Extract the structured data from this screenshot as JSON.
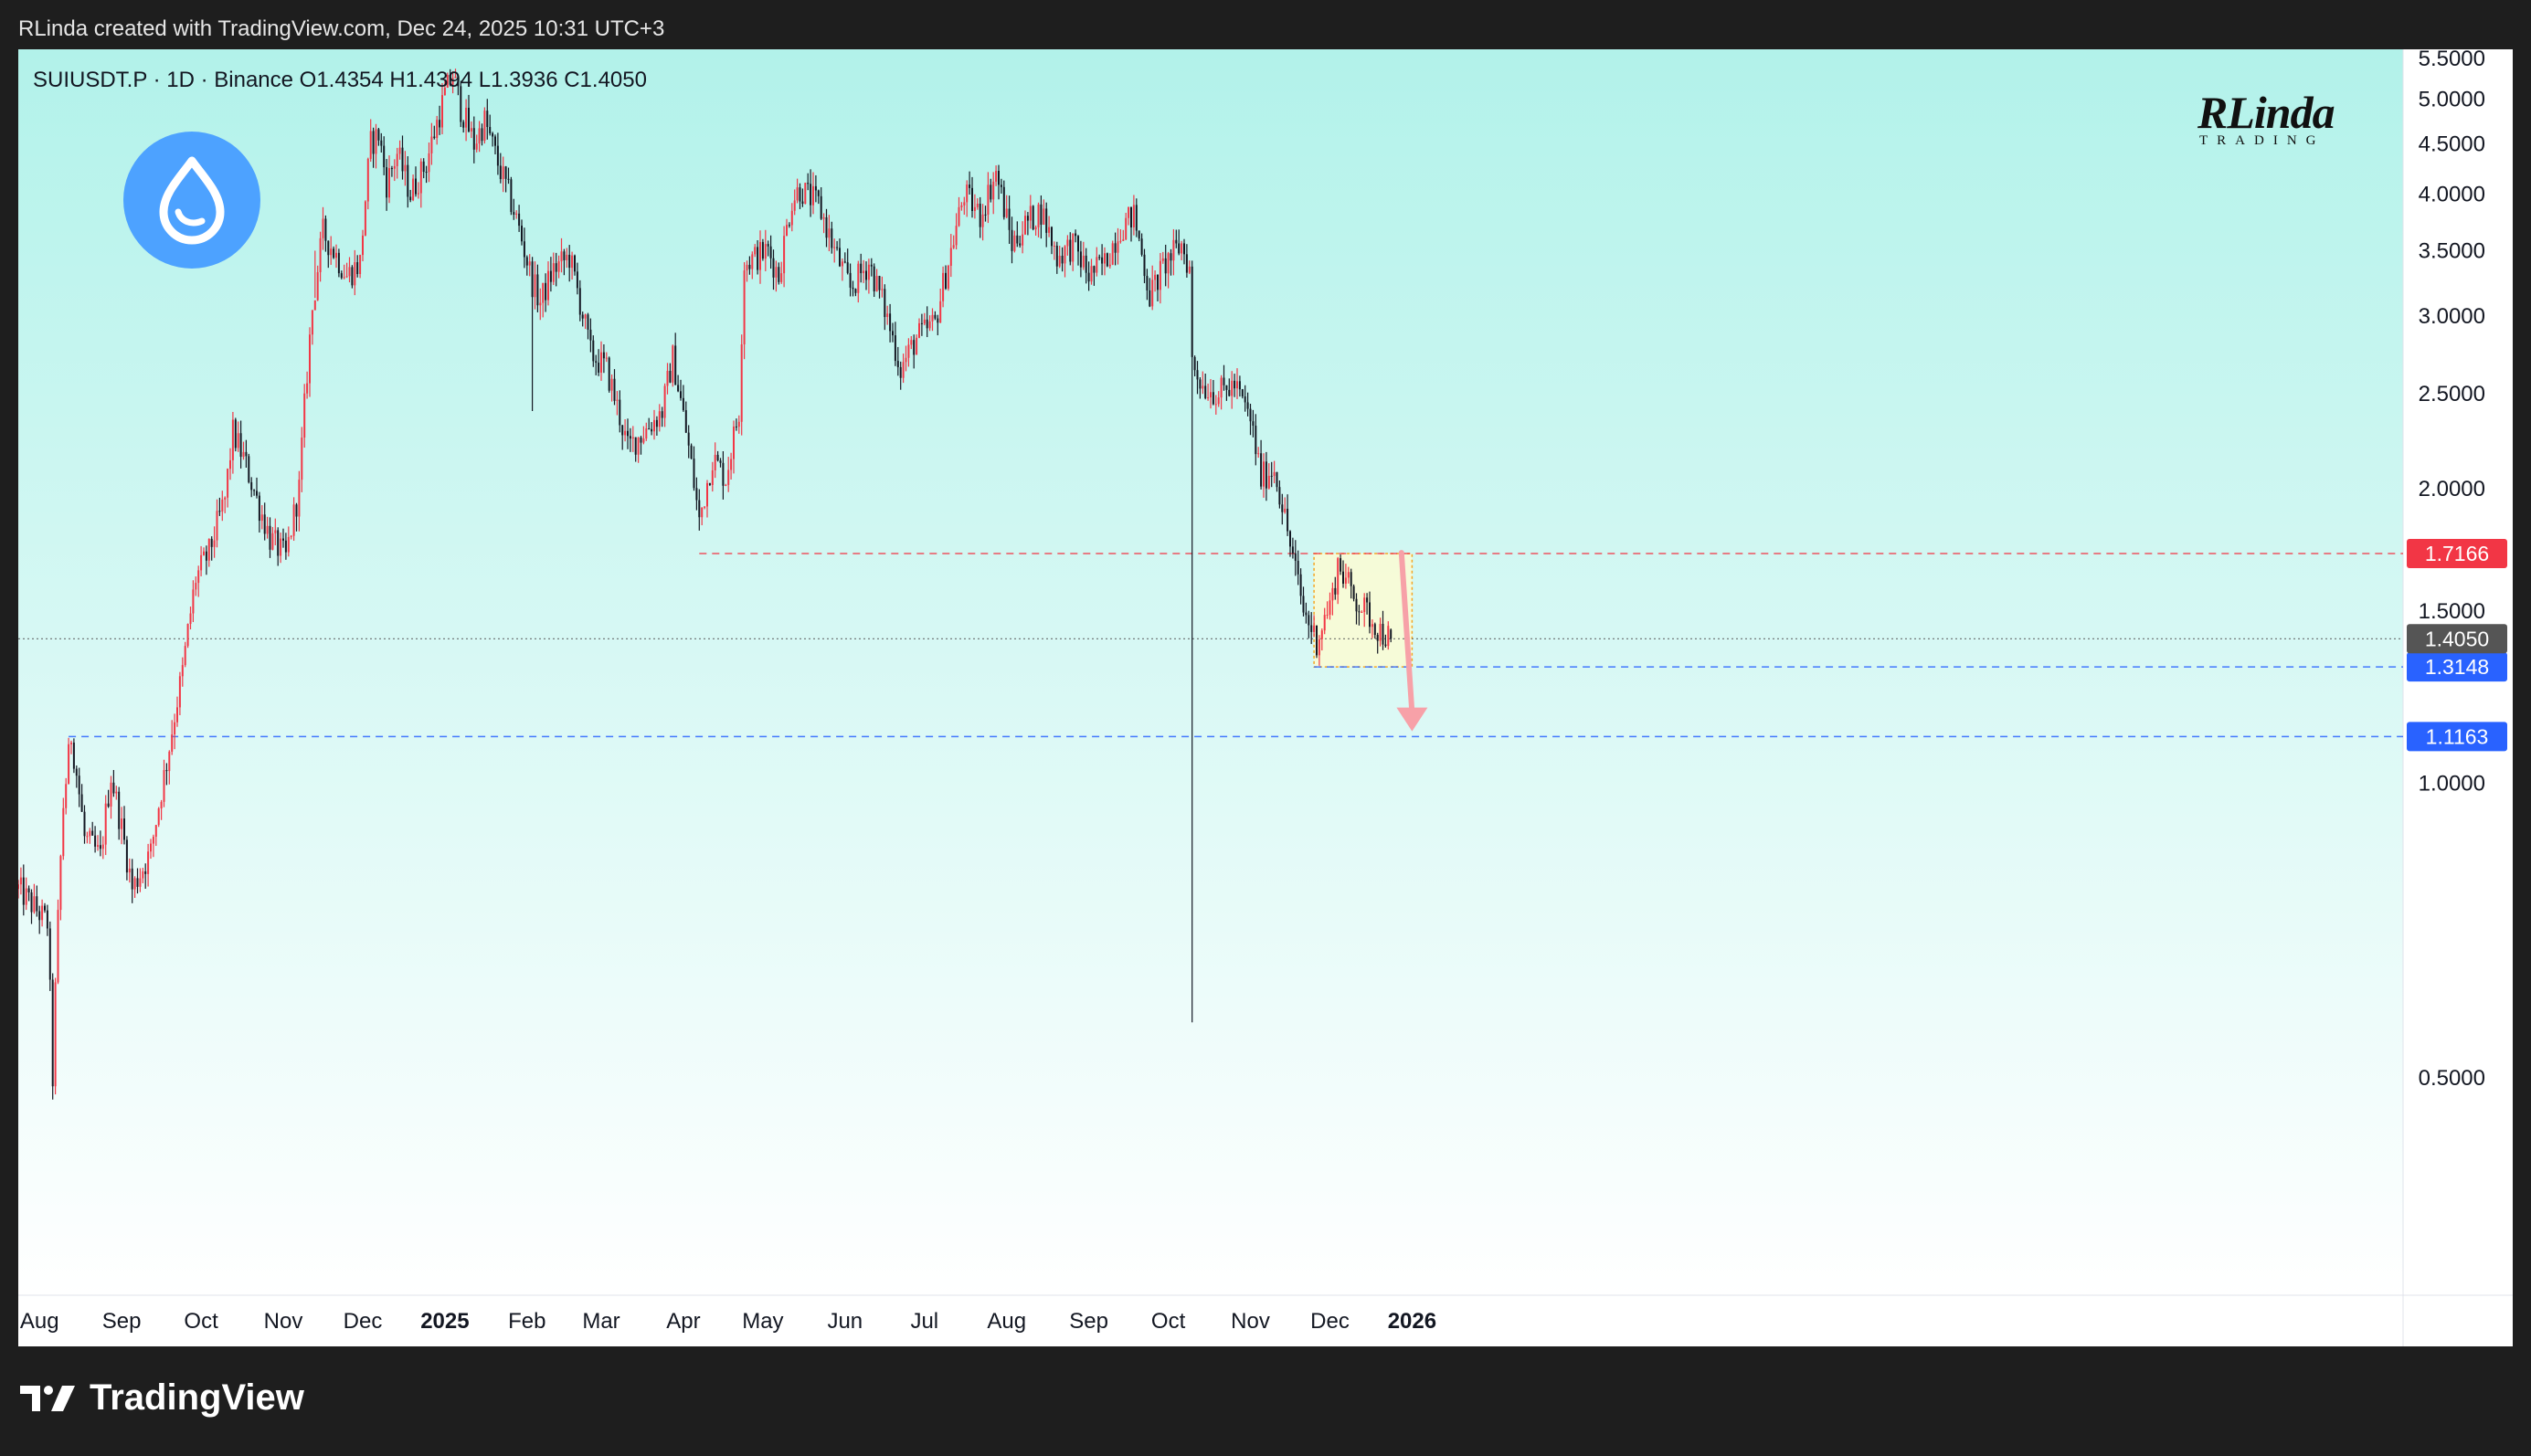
{
  "caption": "RLinda created with TradingView.com, Dec 24, 2025 10:31 UTC+3",
  "symbol_info": "SUIUSDT.P · 1D · Binance  O1.4354  H1.4394  L1.3936  C1.4050",
  "watermark": {
    "main": "RLinda",
    "sub": "TRADING"
  },
  "brand": "TradingView",
  "icons": {
    "sui_logo": "sui-droplet-icon",
    "brand_logo": "tradingview-logo-icon"
  },
  "colors": {
    "up": "#f23645",
    "down": "#131722",
    "red_level": "#f23645",
    "blue_level": "#2962ff",
    "last_price": "#555555",
    "zone_fill": "#fcfbd2",
    "zone_border": "#f5a623",
    "arrow": "#f7a1a8",
    "bg_top": "#b2f2ea",
    "bg_bottom": "#ffffff",
    "sui_blue": "#4da2ff"
  },
  "chart_data": {
    "type": "candlestick",
    "title": "SUIUSDT.P",
    "interval": "1D",
    "exchange": "Binance",
    "ohlc_last": {
      "open": 1.4354,
      "high": 1.4394,
      "low": 1.3936,
      "close": 1.405
    },
    "y_ticks": [
      "5.5000",
      "5.0000",
      "4.5000",
      "4.0000",
      "3.5000",
      "3.0000",
      "2.5000",
      "2.0000",
      "1.5000",
      "1.0000",
      "0.5000"
    ],
    "ylim": [
      0.3,
      5.62
    ],
    "x_ticks": [
      {
        "label": "Aug",
        "date": "2024-08-01"
      },
      {
        "label": "Sep",
        "date": "2024-09-01"
      },
      {
        "label": "Oct",
        "date": "2024-10-01"
      },
      {
        "label": "Nov",
        "date": "2024-11-01"
      },
      {
        "label": "Dec",
        "date": "2024-12-01"
      },
      {
        "label": "2025",
        "date": "2025-01-01",
        "bold": true
      },
      {
        "label": "Feb",
        "date": "2025-02-01"
      },
      {
        "label": "Mar",
        "date": "2025-03-01"
      },
      {
        "label": "Apr",
        "date": "2025-04-01"
      },
      {
        "label": "May",
        "date": "2025-05-01"
      },
      {
        "label": "Jun",
        "date": "2025-06-01"
      },
      {
        "label": "Jul",
        "date": "2025-07-01"
      },
      {
        "label": "Aug",
        "date": "2025-08-01"
      },
      {
        "label": "Sep",
        "date": "2025-09-01"
      },
      {
        "label": "Oct",
        "date": "2025-10-01"
      },
      {
        "label": "Nov",
        "date": "2025-11-01"
      },
      {
        "label": "Dec",
        "date": "2025-12-01"
      },
      {
        "label": "2026",
        "date": "2026-01-01",
        "bold": true
      }
    ],
    "close_path": [
      {
        "date": "2024-07-24",
        "price": 0.78
      },
      {
        "date": "2024-08-04",
        "price": 0.72
      },
      {
        "date": "2024-08-06",
        "price": 0.5
      },
      {
        "date": "2024-08-10",
        "price": 0.95
      },
      {
        "date": "2024-08-13",
        "price": 1.12
      },
      {
        "date": "2024-08-18",
        "price": 0.88
      },
      {
        "date": "2024-08-24",
        "price": 0.84
      },
      {
        "date": "2024-08-28",
        "price": 1.02
      },
      {
        "date": "2024-09-05",
        "price": 0.78
      },
      {
        "date": "2024-09-12",
        "price": 0.85
      },
      {
        "date": "2024-09-18",
        "price": 1.05
      },
      {
        "date": "2024-09-24",
        "price": 1.3
      },
      {
        "date": "2024-09-29",
        "price": 1.62
      },
      {
        "date": "2024-10-04",
        "price": 1.72
      },
      {
        "date": "2024-10-10",
        "price": 1.95
      },
      {
        "date": "2024-10-13",
        "price": 2.28
      },
      {
        "date": "2024-10-17",
        "price": 2.15
      },
      {
        "date": "2024-10-22",
        "price": 1.95
      },
      {
        "date": "2024-10-27",
        "price": 1.78
      },
      {
        "date": "2024-11-02",
        "price": 1.7
      },
      {
        "date": "2024-11-07",
        "price": 2.0
      },
      {
        "date": "2024-11-12",
        "price": 3.05
      },
      {
        "date": "2024-11-16",
        "price": 3.65
      },
      {
        "date": "2024-11-20",
        "price": 3.5
      },
      {
        "date": "2024-11-25",
        "price": 3.3
      },
      {
        "date": "2024-11-30",
        "price": 3.4
      },
      {
        "date": "2024-12-04",
        "price": 4.5
      },
      {
        "date": "2024-12-07",
        "price": 4.6
      },
      {
        "date": "2024-12-10",
        "price": 4.1
      },
      {
        "date": "2024-12-14",
        "price": 4.4
      },
      {
        "date": "2024-12-19",
        "price": 4.0
      },
      {
        "date": "2024-12-25",
        "price": 4.3
      },
      {
        "date": "2025-01-01",
        "price": 5.05
      },
      {
        "date": "2025-01-04",
        "price": 5.3
      },
      {
        "date": "2025-01-07",
        "price": 4.9
      },
      {
        "date": "2025-01-12",
        "price": 4.5
      },
      {
        "date": "2025-01-16",
        "price": 4.75
      },
      {
        "date": "2025-01-21",
        "price": 4.3
      },
      {
        "date": "2025-01-27",
        "price": 3.85
      },
      {
        "date": "2025-02-03",
        "price": 3.25
      },
      {
        "date": "2025-02-06",
        "price": 3.1
      },
      {
        "date": "2025-02-11",
        "price": 3.35
      },
      {
        "date": "2025-02-17",
        "price": 3.45
      },
      {
        "date": "2025-02-25",
        "price": 2.75
      },
      {
        "date": "2025-03-03",
        "price": 2.65
      },
      {
        "date": "2025-03-11",
        "price": 2.2
      },
      {
        "date": "2025-03-18",
        "price": 2.3
      },
      {
        "date": "2025-03-24",
        "price": 2.4
      },
      {
        "date": "2025-03-28",
        "price": 2.72
      },
      {
        "date": "2025-04-03",
        "price": 2.2
      },
      {
        "date": "2025-04-07",
        "price": 1.85
      },
      {
        "date": "2025-04-12",
        "price": 2.15
      },
      {
        "date": "2025-04-17",
        "price": 2.05
      },
      {
        "date": "2025-04-22",
        "price": 2.4
      },
      {
        "date": "2025-04-24",
        "price": 3.4
      },
      {
        "date": "2025-05-03",
        "price": 3.5
      },
      {
        "date": "2025-05-07",
        "price": 3.3
      },
      {
        "date": "2025-05-12",
        "price": 3.95
      },
      {
        "date": "2025-05-15",
        "price": 4.05
      },
      {
        "date": "2025-05-22",
        "price": 3.9
      },
      {
        "date": "2025-05-28",
        "price": 3.5
      },
      {
        "date": "2025-06-03",
        "price": 3.2
      },
      {
        "date": "2025-06-10",
        "price": 3.4
      },
      {
        "date": "2025-06-16",
        "price": 3.05
      },
      {
        "date": "2025-06-22",
        "price": 2.65
      },
      {
        "date": "2025-06-28",
        "price": 2.85
      },
      {
        "date": "2025-07-05",
        "price": 2.95
      },
      {
        "date": "2025-07-11",
        "price": 3.5
      },
      {
        "date": "2025-07-16",
        "price": 4.0
      },
      {
        "date": "2025-07-22",
        "price": 3.8
      },
      {
        "date": "2025-07-28",
        "price": 4.2
      },
      {
        "date": "2025-08-03",
        "price": 3.55
      },
      {
        "date": "2025-08-09",
        "price": 3.75
      },
      {
        "date": "2025-08-14",
        "price": 3.85
      },
      {
        "date": "2025-08-20",
        "price": 3.45
      },
      {
        "date": "2025-08-26",
        "price": 3.55
      },
      {
        "date": "2025-09-01",
        "price": 3.3
      },
      {
        "date": "2025-09-07",
        "price": 3.4
      },
      {
        "date": "2025-09-13",
        "price": 3.7
      },
      {
        "date": "2025-09-18",
        "price": 3.8
      },
      {
        "date": "2025-09-24",
        "price": 3.15
      },
      {
        "date": "2025-09-30",
        "price": 3.4
      },
      {
        "date": "2025-10-06",
        "price": 3.55
      },
      {
        "date": "2025-10-09",
        "price": 3.35
      },
      {
        "date": "2025-10-10",
        "price": 2.7
      },
      {
        "date": "2025-10-14",
        "price": 2.55
      },
      {
        "date": "2025-10-20",
        "price": 2.5
      },
      {
        "date": "2025-10-26",
        "price": 2.55
      },
      {
        "date": "2025-11-01",
        "price": 2.35
      },
      {
        "date": "2025-11-05",
        "price": 2.05
      },
      {
        "date": "2025-11-10",
        "price": 2.1
      },
      {
        "date": "2025-11-16",
        "price": 1.75
      },
      {
        "date": "2025-11-21",
        "price": 1.5
      },
      {
        "date": "2025-11-26",
        "price": 1.4
      },
      {
        "date": "2025-12-02",
        "price": 1.55
      },
      {
        "date": "2025-12-04",
        "price": 1.68
      },
      {
        "date": "2025-12-10",
        "price": 1.55
      },
      {
        "date": "2025-12-16",
        "price": 1.48
      },
      {
        "date": "2025-12-20",
        "price": 1.43
      },
      {
        "date": "2025-12-24",
        "price": 1.405
      }
    ],
    "spikes": [
      {
        "date": "2025-10-10",
        "low": 0.57
      },
      {
        "date": "2025-02-03",
        "low": 2.4
      },
      {
        "date": "2024-11-13",
        "low": 3.5
      }
    ],
    "levels": [
      {
        "price": 1.7166,
        "label": "1.7166",
        "color": "#f23645",
        "start_date": "2025-04-07",
        "style": "dashed"
      },
      {
        "price": 1.3148,
        "label": "1.3148",
        "color": "#2962ff",
        "start_date": "2025-11-25",
        "style": "dashed"
      },
      {
        "price": 1.1163,
        "label": "1.1163",
        "color": "#2962ff",
        "start_date": "2024-08-12",
        "style": "dashed"
      },
      {
        "price": 1.405,
        "label": "1.4050",
        "color": "#555555",
        "start_date": "2024-07-24",
        "style": "dotted",
        "last_price": true
      }
    ],
    "zone": {
      "start_date": "2025-11-25",
      "end_date": "2026-01-01",
      "top": 1.7166,
      "bottom": 1.3148
    },
    "projection_arrow": {
      "from_date": "2025-12-28",
      "from_price": 1.72,
      "to_date": "2026-01-01",
      "to_price": 1.13
    }
  }
}
